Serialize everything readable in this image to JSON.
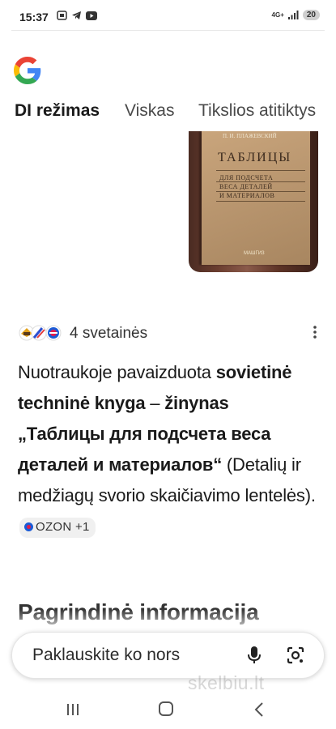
{
  "status_bar": {
    "time": "15:37",
    "network": "4G+",
    "battery": "20"
  },
  "tabs": [
    {
      "label": "DI režimas",
      "active": true
    },
    {
      "label": "Viskas",
      "active": false
    },
    {
      "label": "Tikslios atitiktys",
      "active": false
    }
  ],
  "book_image": {
    "author": "П. И. ПЛАЖЕВСКИЙ",
    "title": "ТАБЛИЦЫ",
    "sub_1": "ДЛЯ ПОДСЧЕТА",
    "sub_2": "ВЕСА ДЕТАЛЕЙ",
    "sub_3": "И МАТЕРИАЛОВ",
    "publisher": "МАШГИЗ"
  },
  "sources": {
    "label": "4 svetainės"
  },
  "answer": {
    "part1": "Nuotraukoje pavaizduota ",
    "bold1": "sovietinė techninė knyga",
    "part2": " – ",
    "bold2": "žinynas „Таблицы для подсчета веса деталей и материалов“",
    "part3": " (Detalių ir medžiagų svorio skaičiavimo lentelės).",
    "citation": "OZON +1"
  },
  "section": {
    "heading": "Pagrindinė informacija"
  },
  "ask_bar": {
    "placeholder": "Paklauskite ko nors"
  },
  "watermark": "skelbiu.lt",
  "colors": {
    "google_blue": "#4285F4",
    "google_red": "#EA4335",
    "google_yellow": "#FBBC05",
    "google_green": "#34A853",
    "ozon_blue": "#1a5bd6",
    "ozon_pink": "#e01c4d"
  }
}
